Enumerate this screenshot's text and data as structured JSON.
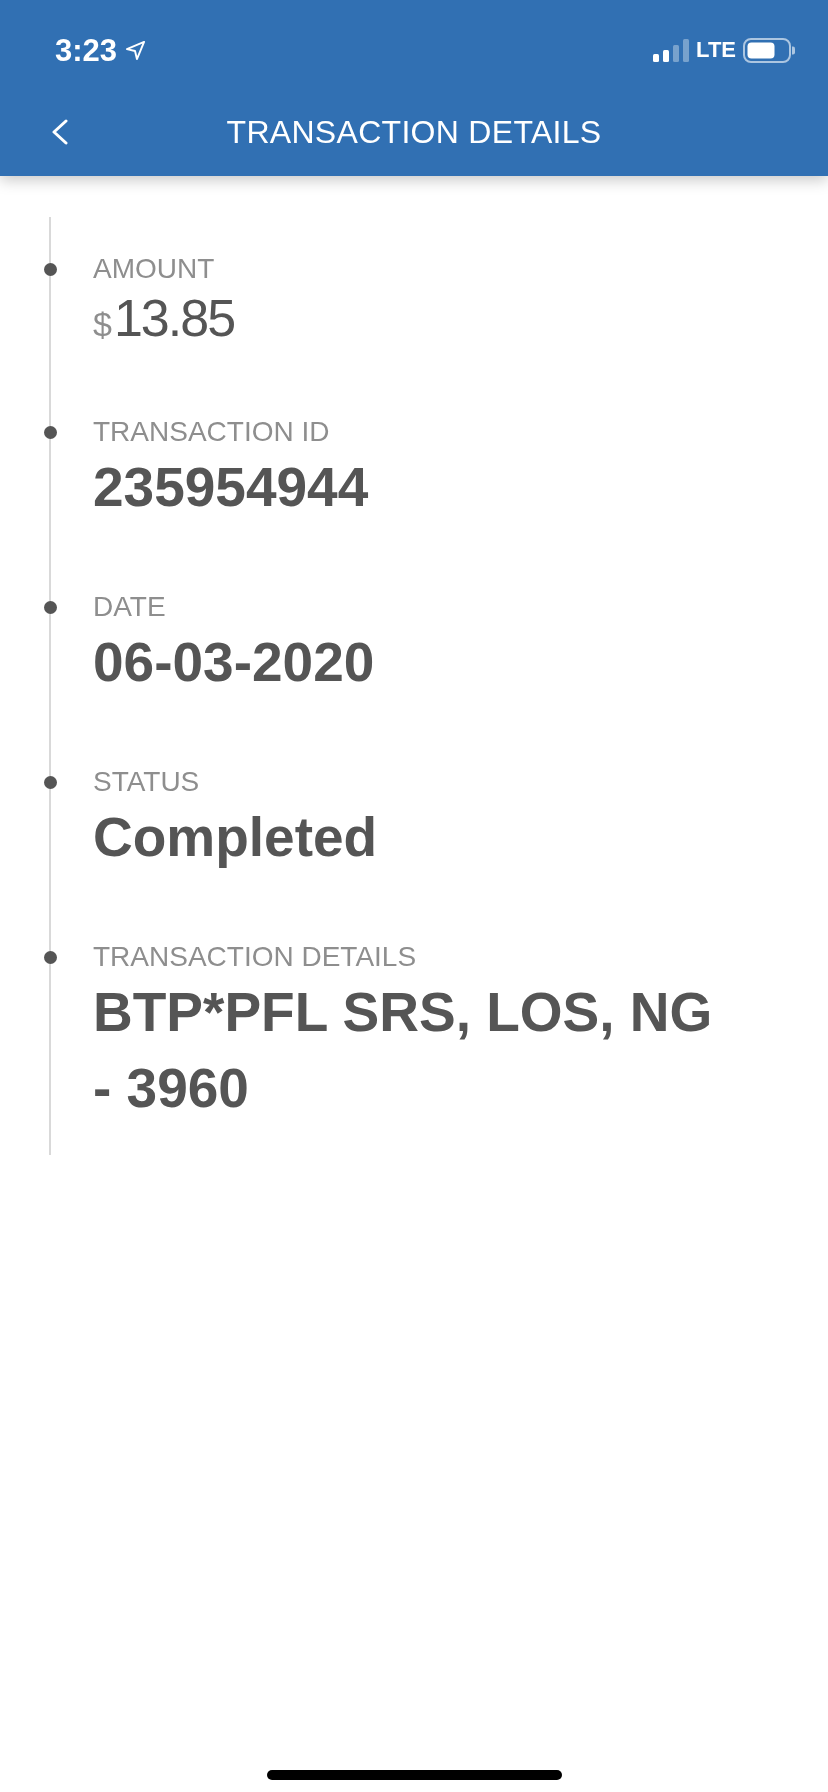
{
  "status_bar": {
    "time": "3:23",
    "network": "LTE"
  },
  "header": {
    "title": "TRANSACTION DETAILS"
  },
  "details": [
    {
      "kind": "amount",
      "label": "AMOUNT",
      "currency": "$",
      "value": "13.85"
    },
    {
      "kind": "text",
      "label": "TRANSACTION ID",
      "value": "235954944"
    },
    {
      "kind": "text",
      "label": "DATE",
      "value": "06-03-2020"
    },
    {
      "kind": "text",
      "label": "STATUS",
      "value": "Completed"
    },
    {
      "kind": "text",
      "label": "TRANSACTION DETAILS",
      "value": "BTP*PFL SRS, LOS, NG - 3960"
    }
  ]
}
